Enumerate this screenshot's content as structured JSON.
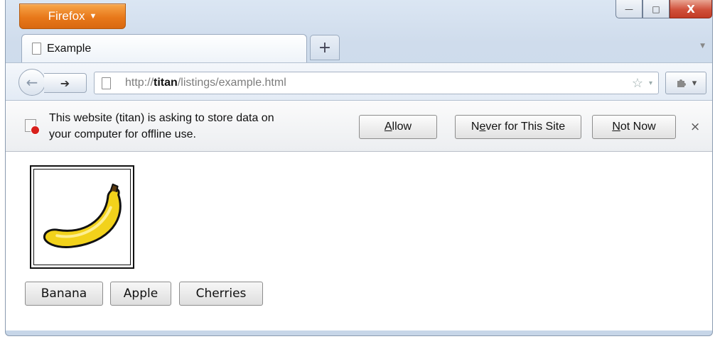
{
  "browser": {
    "menu_button": "Firefox",
    "menu_caret": "▼",
    "window_controls": {
      "minimize": "—",
      "maximize": "□",
      "close": "X"
    }
  },
  "tabs": [
    {
      "title": "Example"
    }
  ],
  "new_tab_symbol": "+",
  "navbar": {
    "url_prefix": "http://",
    "url_host": "titan",
    "url_path": "/listings/example.html",
    "bookmark_star": "☆",
    "dropdown_caret": "▾"
  },
  "notification": {
    "message_line1": "This website (titan) is asking to store data on",
    "message_line2": "your computer for offline use.",
    "allow": {
      "accesskey": "A",
      "rest": "llow"
    },
    "never": {
      "pre": "N",
      "accesskey": "e",
      "rest": "ver for This Site"
    },
    "not_now": {
      "accesskey": "N",
      "rest": "ot Now"
    },
    "close": "×"
  },
  "content": {
    "image_alt": "banana",
    "buttons": [
      "Banana",
      "Apple",
      "Cherries"
    ]
  },
  "colors": {
    "firefox_orange": "#e8781a",
    "close_red": "#c23b25",
    "banana_yellow": "#f2d21b"
  }
}
